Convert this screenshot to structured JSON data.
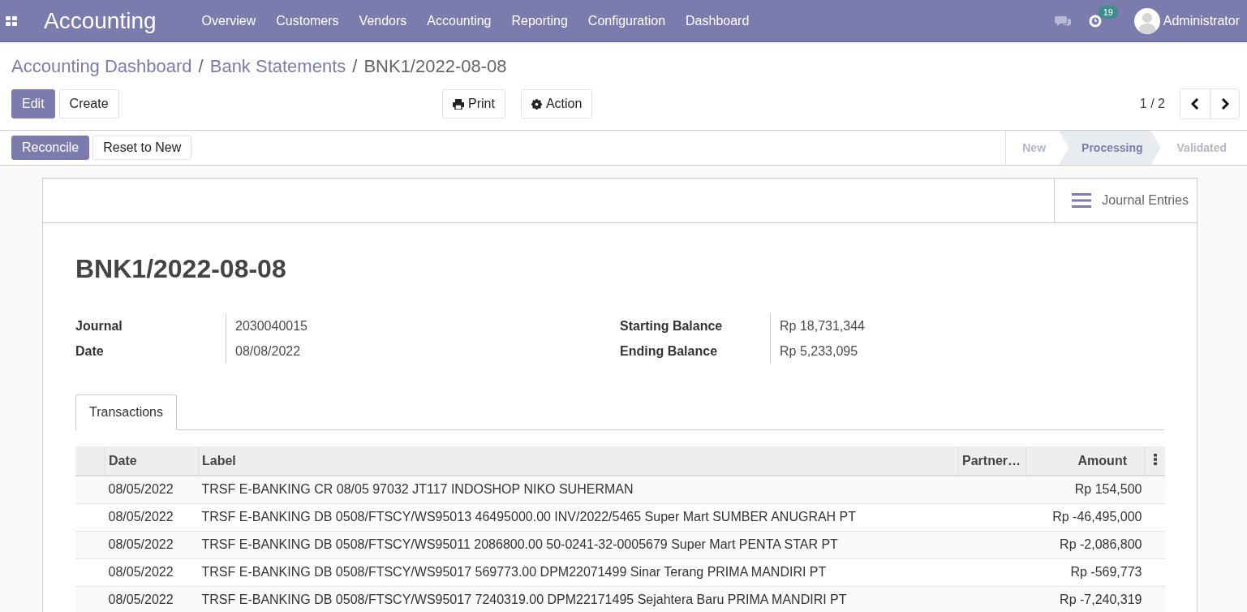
{
  "navbar": {
    "app_title": "Accounting",
    "menu": [
      "Overview",
      "Customers",
      "Vendors",
      "Accounting",
      "Reporting",
      "Configuration",
      "Dashboard"
    ],
    "activity_count": "19",
    "user": "Administrator"
  },
  "breadcrumb": [
    "Accounting Dashboard",
    "Bank Statements",
    "BNK1/2022-08-08"
  ],
  "breadcrumb_separator": "/",
  "control_panel": {
    "buttons": [
      {
        "label": "Edit",
        "kind": "primary"
      },
      {
        "label": "Create",
        "kind": "secondary"
      }
    ],
    "print": "Print",
    "action": "Action",
    "pager": "1 / 2"
  },
  "statusbar": {
    "buttons": [
      {
        "label": "Reconcile",
        "kind": "primary"
      },
      {
        "label": "Reset to New",
        "kind": "secondary"
      }
    ],
    "stages": [
      {
        "label": "New",
        "selected": false
      },
      {
        "label": "Processing",
        "selected": true
      },
      {
        "label": "Validated",
        "selected": false
      }
    ]
  },
  "sheet": {
    "smart_button": "Journal Entries",
    "title": "BNK1/2022-08-08",
    "left_fields": [
      {
        "label": "Journal",
        "value": "2030040015"
      },
      {
        "label": "Date",
        "value": "08/08/2022"
      }
    ],
    "right_fields": [
      {
        "label": "Starting Balance",
        "value": "Rp 18,731,344"
      },
      {
        "label": "Ending Balance",
        "value": "Rp 5,233,095"
      }
    ],
    "tabs": [
      {
        "label": "Transactions",
        "selected": true
      }
    ],
    "table": {
      "columns": [
        "Date",
        "Label",
        "Partner…",
        "Amount"
      ],
      "rows": [
        {
          "date": "08/05/2022",
          "label": "TRSF E-BANKING CR 08/05 97032 JT117 INDOSHOP NIKO SUHERMAN",
          "amount": "Rp 154,500"
        },
        {
          "date": "08/05/2022",
          "label": "TRSF E-BANKING DB 0508/FTSCY/WS95013 46495000.00 INV/2022/5465 Super Mart SUMBER ANUGRAH PT",
          "amount": "Rp -46,495,000"
        },
        {
          "date": "08/05/2022",
          "label": "TRSF E-BANKING DB 0508/FTSCY/WS95011 2086800.00 50-0241-32-0005679 Super Mart PENTA STAR PT",
          "amount": "Rp -2,086,800"
        },
        {
          "date": "08/05/2022",
          "label": "TRSF E-BANKING DB 0508/FTSCY/WS95017 569773.00 DPM22071499 Sinar Terang PRIMA MANDIRI PT",
          "amount": "Rp -569,773"
        },
        {
          "date": "08/05/2022",
          "label": "TRSF E-BANKING DB 0508/FTSCY/WS95017 7240319.00 DPM22171495 Sejahtera Baru PRIMA MANDIRI PT",
          "amount": "Rp -7,240,319"
        }
      ]
    }
  }
}
